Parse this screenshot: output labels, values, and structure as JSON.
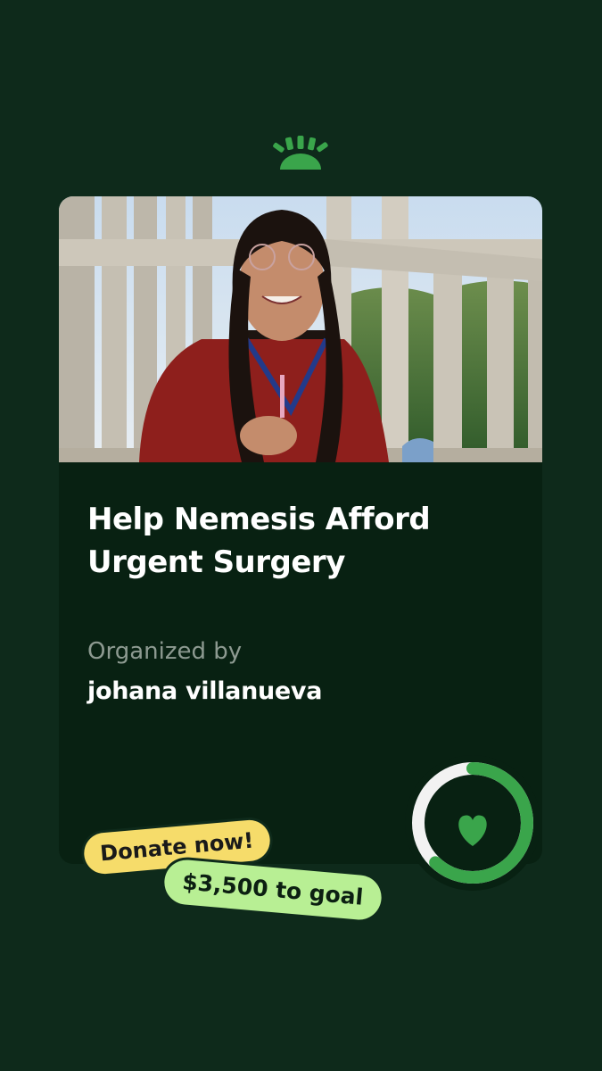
{
  "brand": {
    "logo_icon": "gofundme-logo-icon",
    "accent_color": "#3aa54b"
  },
  "campaign": {
    "photo_icon": "campaign-photo",
    "title": "Help Nemesis Afford Urgent Surgery",
    "organizer_label": "Organized by",
    "organizer_name": "johana villanueva"
  },
  "progress": {
    "fraction": 0.62,
    "ring_color": "#3aa54b",
    "track_color": "#f2f2f2",
    "icon": "heart-icon"
  },
  "badges": {
    "donate_label": "Donate now!",
    "goal_label": "$3,500 to goal",
    "donate_color": "#f6dc6a",
    "goal_color": "#b8ef94"
  }
}
